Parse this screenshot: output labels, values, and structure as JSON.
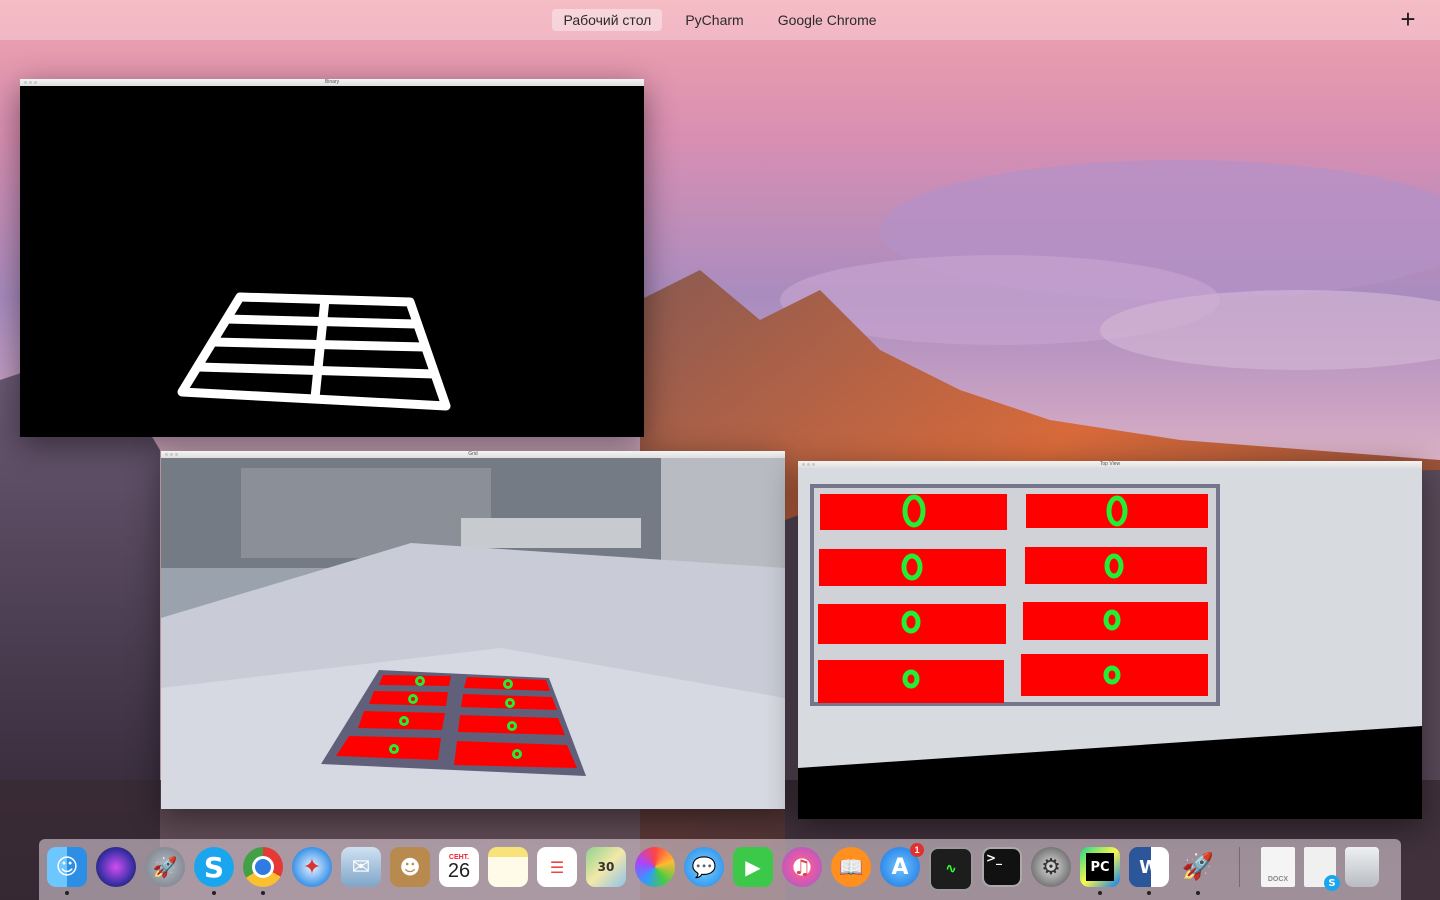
{
  "mission_control": {
    "spaces": [
      "Рабочий стол",
      "PyCharm",
      "Google Chrome"
    ],
    "active_space": "Рабочий стол",
    "add_space_label": "+"
  },
  "windows": {
    "binary": {
      "title": "Binary"
    },
    "camera": {
      "title": "Grid"
    },
    "top_view": {
      "title": "Top View"
    }
  },
  "dock": {
    "apps": [
      {
        "name": "Finder",
        "icon": "finder-icon",
        "running": true
      },
      {
        "name": "Siri",
        "icon": "siri-icon",
        "running": false
      },
      {
        "name": "Launchpad",
        "icon": "launchpad-icon",
        "running": false
      },
      {
        "name": "Skype",
        "icon": "skype-icon",
        "running": true
      },
      {
        "name": "Google Chrome",
        "icon": "chrome-icon",
        "running": true
      },
      {
        "name": "Safari",
        "icon": "safari-icon",
        "running": false
      },
      {
        "name": "Mail",
        "icon": "mail-icon",
        "running": false
      },
      {
        "name": "Contacts",
        "icon": "contacts-icon",
        "running": false
      },
      {
        "name": "Calendar",
        "icon": "calendar-icon",
        "running": false,
        "month": "СЕНТ.",
        "day": "26"
      },
      {
        "name": "Notes",
        "icon": "notes-icon",
        "running": false
      },
      {
        "name": "Reminders",
        "icon": "reminders-icon",
        "running": false
      },
      {
        "name": "Maps",
        "icon": "maps-icon",
        "running": false
      },
      {
        "name": "Photos",
        "icon": "photos-icon",
        "running": false
      },
      {
        "name": "Messages",
        "icon": "messages-icon",
        "running": false
      },
      {
        "name": "FaceTime",
        "icon": "facetime-icon",
        "running": false
      },
      {
        "name": "iTunes",
        "icon": "itunes-icon",
        "running": false
      },
      {
        "name": "iBooks",
        "icon": "ibooks-icon",
        "running": false
      },
      {
        "name": "App Store",
        "icon": "app-store-icon",
        "running": false,
        "badge": "1"
      },
      {
        "name": "Activity Monitor",
        "icon": "activity-monitor-icon",
        "running": false
      },
      {
        "name": "Terminal",
        "icon": "terminal-icon",
        "running": false
      },
      {
        "name": "System Preferences",
        "icon": "system-preferences-icon",
        "running": false
      },
      {
        "name": "PyCharm",
        "icon": "pycharm-icon",
        "running": true
      },
      {
        "name": "Microsoft Word",
        "icon": "word-icon",
        "running": true
      },
      {
        "name": "Python Launcher",
        "icon": "rocket-icon",
        "running": true
      }
    ],
    "docs": [
      {
        "name": "Document",
        "icon": "docx-file-icon",
        "label": "DOCX"
      },
      {
        "name": "Downloads",
        "icon": "downloads-stack-icon"
      },
      {
        "name": "Trash",
        "icon": "trash-icon"
      }
    ]
  },
  "colors": {
    "accent_red": "#ff0000",
    "marker_green": "#22ee33",
    "grid_white": "#ffffff"
  }
}
